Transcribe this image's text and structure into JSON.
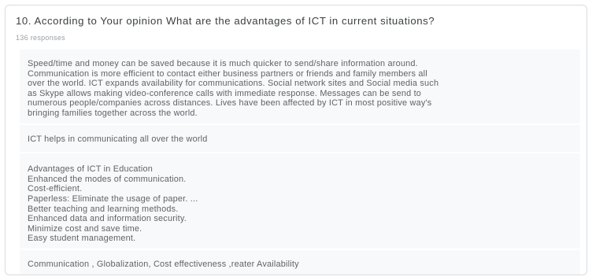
{
  "question": {
    "title": "10. According to Your opinion What are the advantages of ICT in current situations?",
    "response_count": "136 responses"
  },
  "responses": [
    {
      "lines": [
        "Speed/time and money can be saved because it is much quicker to send/share information around.",
        "Communication is more efficient to contact either business partners or friends and family members all",
        "over the world. ICT expands availability for communications. Social network sites and Social media such",
        "as Skype allows making video-conference calls with immediate response. Messages can be send to",
        "numerous people/companies across distances. Lives have been affected by ICT in most positive way's",
        "bringing families together across the world."
      ]
    },
    {
      "lines": [
        "ICT helps in communicating all over the world"
      ]
    },
    {
      "lines": [
        "Advantages of ICT in Education",
        "Enhanced the modes of communication.",
        "Cost-efficient.",
        "Paperless: Eliminate the usage of paper. ...",
        "Better teaching and learning methods.",
        "Enhanced data and information security.",
        "Minimize cost and save time.",
        "Easy student management."
      ]
    },
    {
      "lines": [
        "Communication , Globalization, Cost effectiveness ,reater Availability"
      ]
    }
  ]
}
